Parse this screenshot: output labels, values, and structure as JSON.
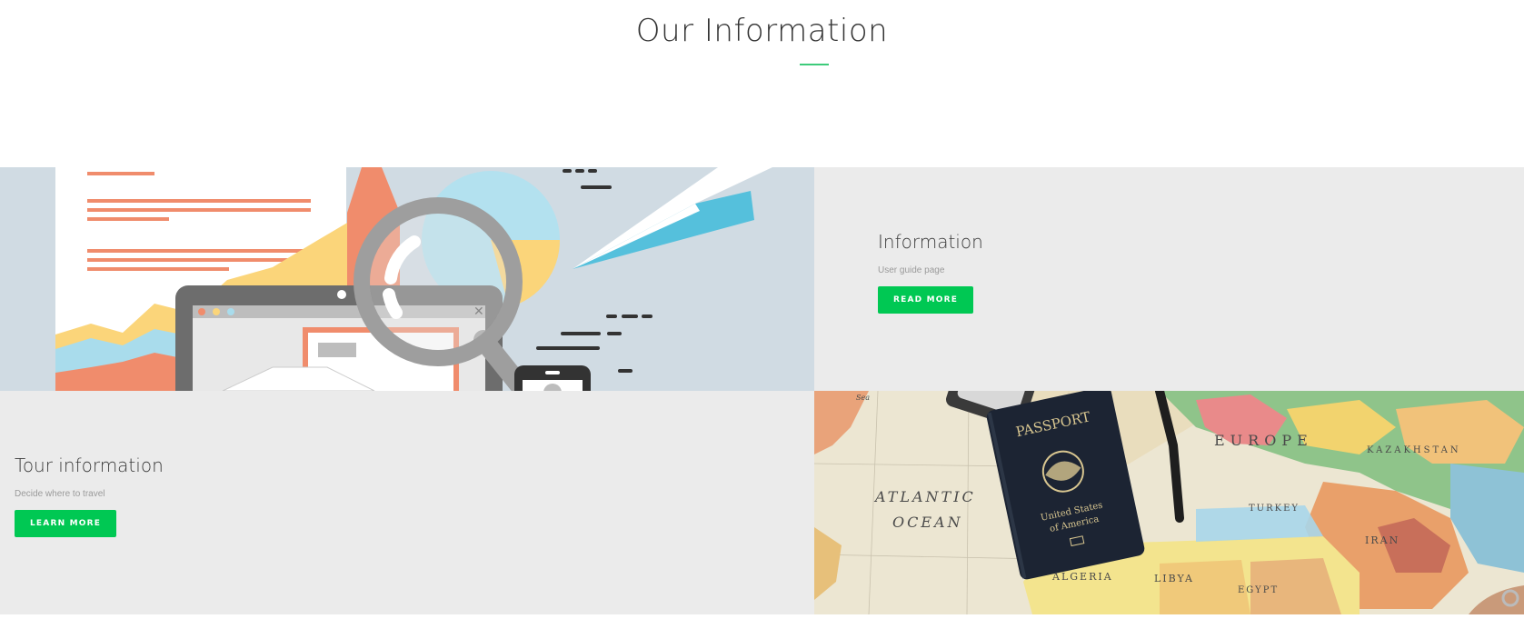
{
  "section": {
    "title": "Our Information"
  },
  "cards": [
    {
      "title": "Information",
      "subtitle": "User guide page",
      "button": "READ MORE"
    },
    {
      "title": "Tour information",
      "subtitle": "Decide where to travel",
      "button": "LEARN MORE"
    }
  ],
  "map_labels": {
    "ocean_line1": "ATLANTIC",
    "ocean_line2": "OCEAN",
    "europe": "EUROPE",
    "kazakhstan": "KAZAKHSTAN",
    "algeria": "ALGERIA",
    "libya": "LIBYA",
    "egypt": "EGYPT",
    "iran": "IRAN",
    "turkey": "TURKEY",
    "sea": "Sea"
  },
  "passport": {
    "title": "PASSPORT",
    "line1": "United States",
    "line2": "of America"
  },
  "colors": {
    "accent_green": "#00c853",
    "underline_green": "#3dcb7a",
    "panel_gray": "#ebebeb",
    "illustration_bg": "#d0dbe3"
  }
}
